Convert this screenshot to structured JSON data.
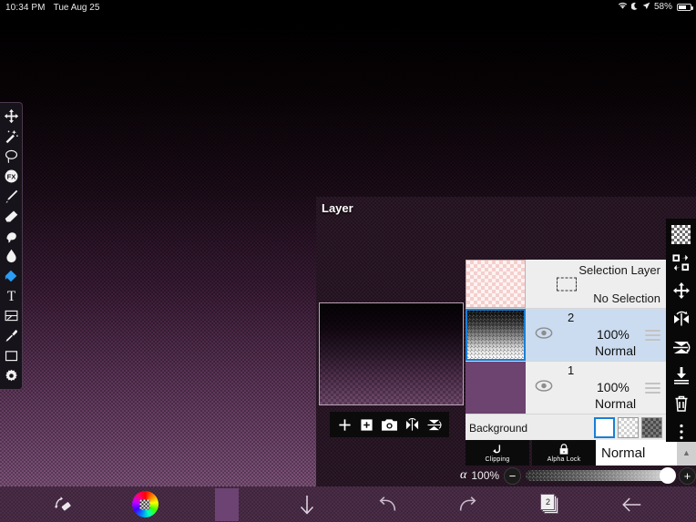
{
  "status_bar": {
    "time": "10:34 PM",
    "date": "Tue Aug 25",
    "battery_percent": "58%",
    "icons": [
      "wifi-icon",
      "moon-icon",
      "location-icon",
      "battery-icon"
    ]
  },
  "tool_rail": {
    "items": [
      {
        "name": "move-tool",
        "icon": "move-arrows-icon",
        "selected": false
      },
      {
        "name": "magic-wand-tool",
        "icon": "magic-wand-icon",
        "selected": false
      },
      {
        "name": "lasso-tool",
        "icon": "lasso-icon",
        "selected": false
      },
      {
        "name": "filter-tool",
        "icon": "fx-icon",
        "selected": false
      },
      {
        "name": "pen-tool",
        "icon": "pen-icon",
        "selected": false
      },
      {
        "name": "eraser-tool",
        "icon": "eraser-icon",
        "selected": false
      },
      {
        "name": "smudge-tool",
        "icon": "smudge-icon",
        "selected": false
      },
      {
        "name": "blur-tool",
        "icon": "water-drop-icon",
        "selected": false
      },
      {
        "name": "bucket-fill-tool",
        "icon": "bucket-diamond-icon",
        "selected": true
      },
      {
        "name": "text-tool",
        "icon": "text-t-icon",
        "selected": false
      },
      {
        "name": "canvas-tool",
        "icon": "canvas-icon",
        "selected": false
      },
      {
        "name": "eyedropper-tool",
        "icon": "eyedropper-icon",
        "selected": false
      },
      {
        "name": "frame-tool",
        "icon": "square-frame-icon",
        "selected": false
      },
      {
        "name": "settings-tool",
        "icon": "gear-icon",
        "selected": false
      }
    ]
  },
  "layer_panel": {
    "title": "Layer",
    "preview_toolbar": [
      {
        "name": "add-layer-button",
        "icon": "plus-icon"
      },
      {
        "name": "duplicate-layer-button",
        "icon": "plus-in-square-icon"
      },
      {
        "name": "camera-import-button",
        "icon": "camera-icon"
      },
      {
        "name": "flip-horizontal-button",
        "icon": "flip-horizontal-icon"
      },
      {
        "name": "flip-vertical-button",
        "icon": "flip-vertical-icon"
      }
    ],
    "selection_layer": {
      "title": "Selection Layer",
      "status": "No Selection"
    },
    "layers": [
      {
        "number": "2",
        "opacity": "100%",
        "blend": "Normal",
        "selected": true,
        "thumb": "gradient-dither"
      },
      {
        "number": "1",
        "opacity": "100%",
        "blend": "Normal",
        "selected": false,
        "thumb": "solid-purple"
      }
    ],
    "background": {
      "label": "Background",
      "swatches": [
        "white",
        "light-checker",
        "dark-checker"
      ],
      "selected_index": 0
    },
    "buttons": {
      "clipping": "Clipping",
      "alpha_lock": "Alpha Lock"
    },
    "blend_mode": {
      "value": "Normal"
    },
    "alpha": {
      "symbol": "α",
      "value": "100%",
      "minus": "−",
      "plus": "+"
    },
    "side_tools": [
      {
        "name": "transparency-button",
        "icon": "checkerboard-icon"
      },
      {
        "name": "swap-layers-button",
        "icon": "swap-layers-icon"
      },
      {
        "name": "move-layer-button",
        "icon": "move-arrows-icon"
      },
      {
        "name": "flip-horizontal-button",
        "icon": "flip-horizontal-icon"
      },
      {
        "name": "flip-vertical-button",
        "icon": "flip-vertical-icon"
      },
      {
        "name": "merge-down-button",
        "icon": "merge-down-icon"
      },
      {
        "name": "delete-layer-button",
        "icon": "trash-icon"
      },
      {
        "name": "more-options-button",
        "icon": "dots-vertical-icon"
      }
    ]
  },
  "bottom_bar": {
    "items": [
      {
        "name": "transform-tool-button",
        "icon": "transform-icon",
        "label": ""
      },
      {
        "name": "color-wheel-button",
        "icon": "color-wheel-icon",
        "label": ""
      },
      {
        "name": "current-color-swatch",
        "icon": "color-swatch-icon",
        "label": ""
      },
      {
        "name": "download-button",
        "icon": "arrow-down-icon",
        "label": ""
      },
      {
        "name": "undo-button",
        "icon": "undo-arrow-icon",
        "label": ""
      },
      {
        "name": "redo-button",
        "icon": "redo-arrow-icon",
        "label": ""
      },
      {
        "name": "layers-button",
        "icon": "layers-stack-icon",
        "label": "2"
      },
      {
        "name": "back-button",
        "icon": "arrow-left-icon",
        "label": ""
      }
    ]
  },
  "colors": {
    "accent_blue": "#1a7fd4",
    "panel_light": "#eeeeee",
    "selected_row": "#ccdcf0",
    "bottom_bar": "#4b2d48",
    "layer_solid_purple": "#6d4370"
  }
}
